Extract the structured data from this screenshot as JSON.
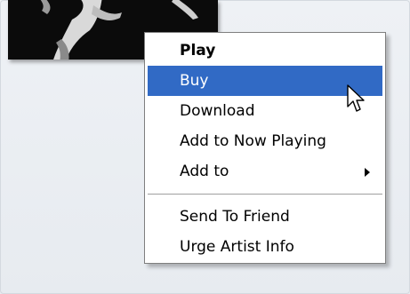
{
  "context_menu": {
    "items": [
      {
        "label": "Play",
        "bold": true,
        "selected": false,
        "has_submenu": false
      },
      {
        "label": "Buy",
        "bold": false,
        "selected": true,
        "has_submenu": false
      },
      {
        "label": "Download",
        "bold": false,
        "selected": false,
        "has_submenu": false
      },
      {
        "label": "Add to Now Playing",
        "bold": false,
        "selected": false,
        "has_submenu": false
      },
      {
        "label": "Add to",
        "bold": false,
        "selected": false,
        "has_submenu": true
      },
      {
        "label": "Send To Friend",
        "bold": false,
        "selected": false,
        "has_submenu": false
      },
      {
        "label": "Urge Artist Info",
        "bold": false,
        "selected": false,
        "has_submenu": false
      }
    ]
  },
  "colors": {
    "highlight": "#316ac5",
    "backdrop": "#e9edf2"
  },
  "icons": {
    "submenu": "chevron-right-icon",
    "pointer": "mouse-cursor-icon"
  }
}
